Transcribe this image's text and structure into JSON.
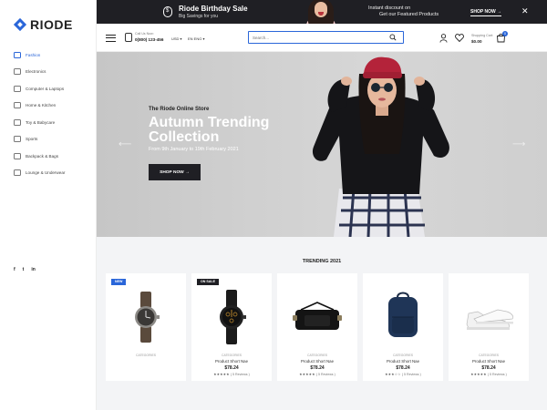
{
  "brand": {
    "name": "RIODE",
    "accent": "#2a66d9",
    "dark": "#1f1f24"
  },
  "sidebar": {
    "categories": [
      {
        "label": "Fashion",
        "icon": "hanger-icon",
        "active": true
      },
      {
        "label": "Electronics",
        "icon": "television-icon"
      },
      {
        "label": "Computer & Laptops",
        "icon": "laptop-icon"
      },
      {
        "label": "Home & Kitchen",
        "icon": "sofa-icon"
      },
      {
        "label": "Toy & Babycare",
        "icon": "baby-icon"
      },
      {
        "label": "Sports",
        "icon": "ball-icon"
      },
      {
        "label": "Backpack & Bags",
        "icon": "backpack-icon"
      },
      {
        "label": "Lounge & Underwear",
        "icon": "underwear-icon"
      }
    ],
    "social": [
      "f",
      "t",
      "in"
    ]
  },
  "topbar": {
    "promo_title": "Riode Birthday Sale",
    "promo_subtitle": "Big Savings for you",
    "instant_line1": "Instant discount on",
    "instant_line2": "Get our Featured Products",
    "shop_now": "SHOP NOW →",
    "close": "✕"
  },
  "header": {
    "call_label": "Call Us Now:",
    "call_number": "0(800) 123-456",
    "currency": "USD ▾",
    "language": "EN ENG ▾",
    "search_placeholder": "Search...",
    "shipping_label": "Shopping Cart:",
    "shipping_amount": "$0.00",
    "cart_count": "0"
  },
  "hero": {
    "eyebrow": "The Riode Online Store",
    "title": "Autumn Trending Collection",
    "date": "From 9th January to 19th February 2021",
    "button": "SHOP NOW →",
    "prev": "⟵",
    "next": "⟶"
  },
  "trending": {
    "title": "TRENDING 2021",
    "products": [
      {
        "badge": "NEW",
        "badge_type": "new",
        "category": "CATEGORIES",
        "name": "",
        "price": "",
        "stars": "",
        "reviews": "",
        "image": "watch-icon"
      },
      {
        "badge": "ON SALE",
        "badge_type": "sale",
        "category": "CATEGORIES",
        "name": "Product Short Nae",
        "price": "$78.24",
        "stars": "★★★★★",
        "reviews": "( 5 Reviews )",
        "image": "watch-icon"
      },
      {
        "badge": "",
        "badge_type": "",
        "category": "CATEGORIES",
        "name": "Product Short Nae",
        "price": "$78.24",
        "stars": "★★★★★",
        "reviews": "( 5 Reviews )",
        "image": "bag-icon"
      },
      {
        "badge": "",
        "badge_type": "",
        "category": "CATEGORIES",
        "name": "Product Short Nae",
        "price": "$78.24",
        "stars": "★★★☆☆",
        "reviews": "( 5 Reviews )",
        "image": "backpack-icon"
      },
      {
        "badge": "",
        "badge_type": "",
        "category": "CATEGORIES",
        "name": "Product Short Nae",
        "price": "$78.24",
        "stars": "★★★★★",
        "reviews": "( 5 Reviews )",
        "image": "sneaker-icon"
      }
    ]
  }
}
